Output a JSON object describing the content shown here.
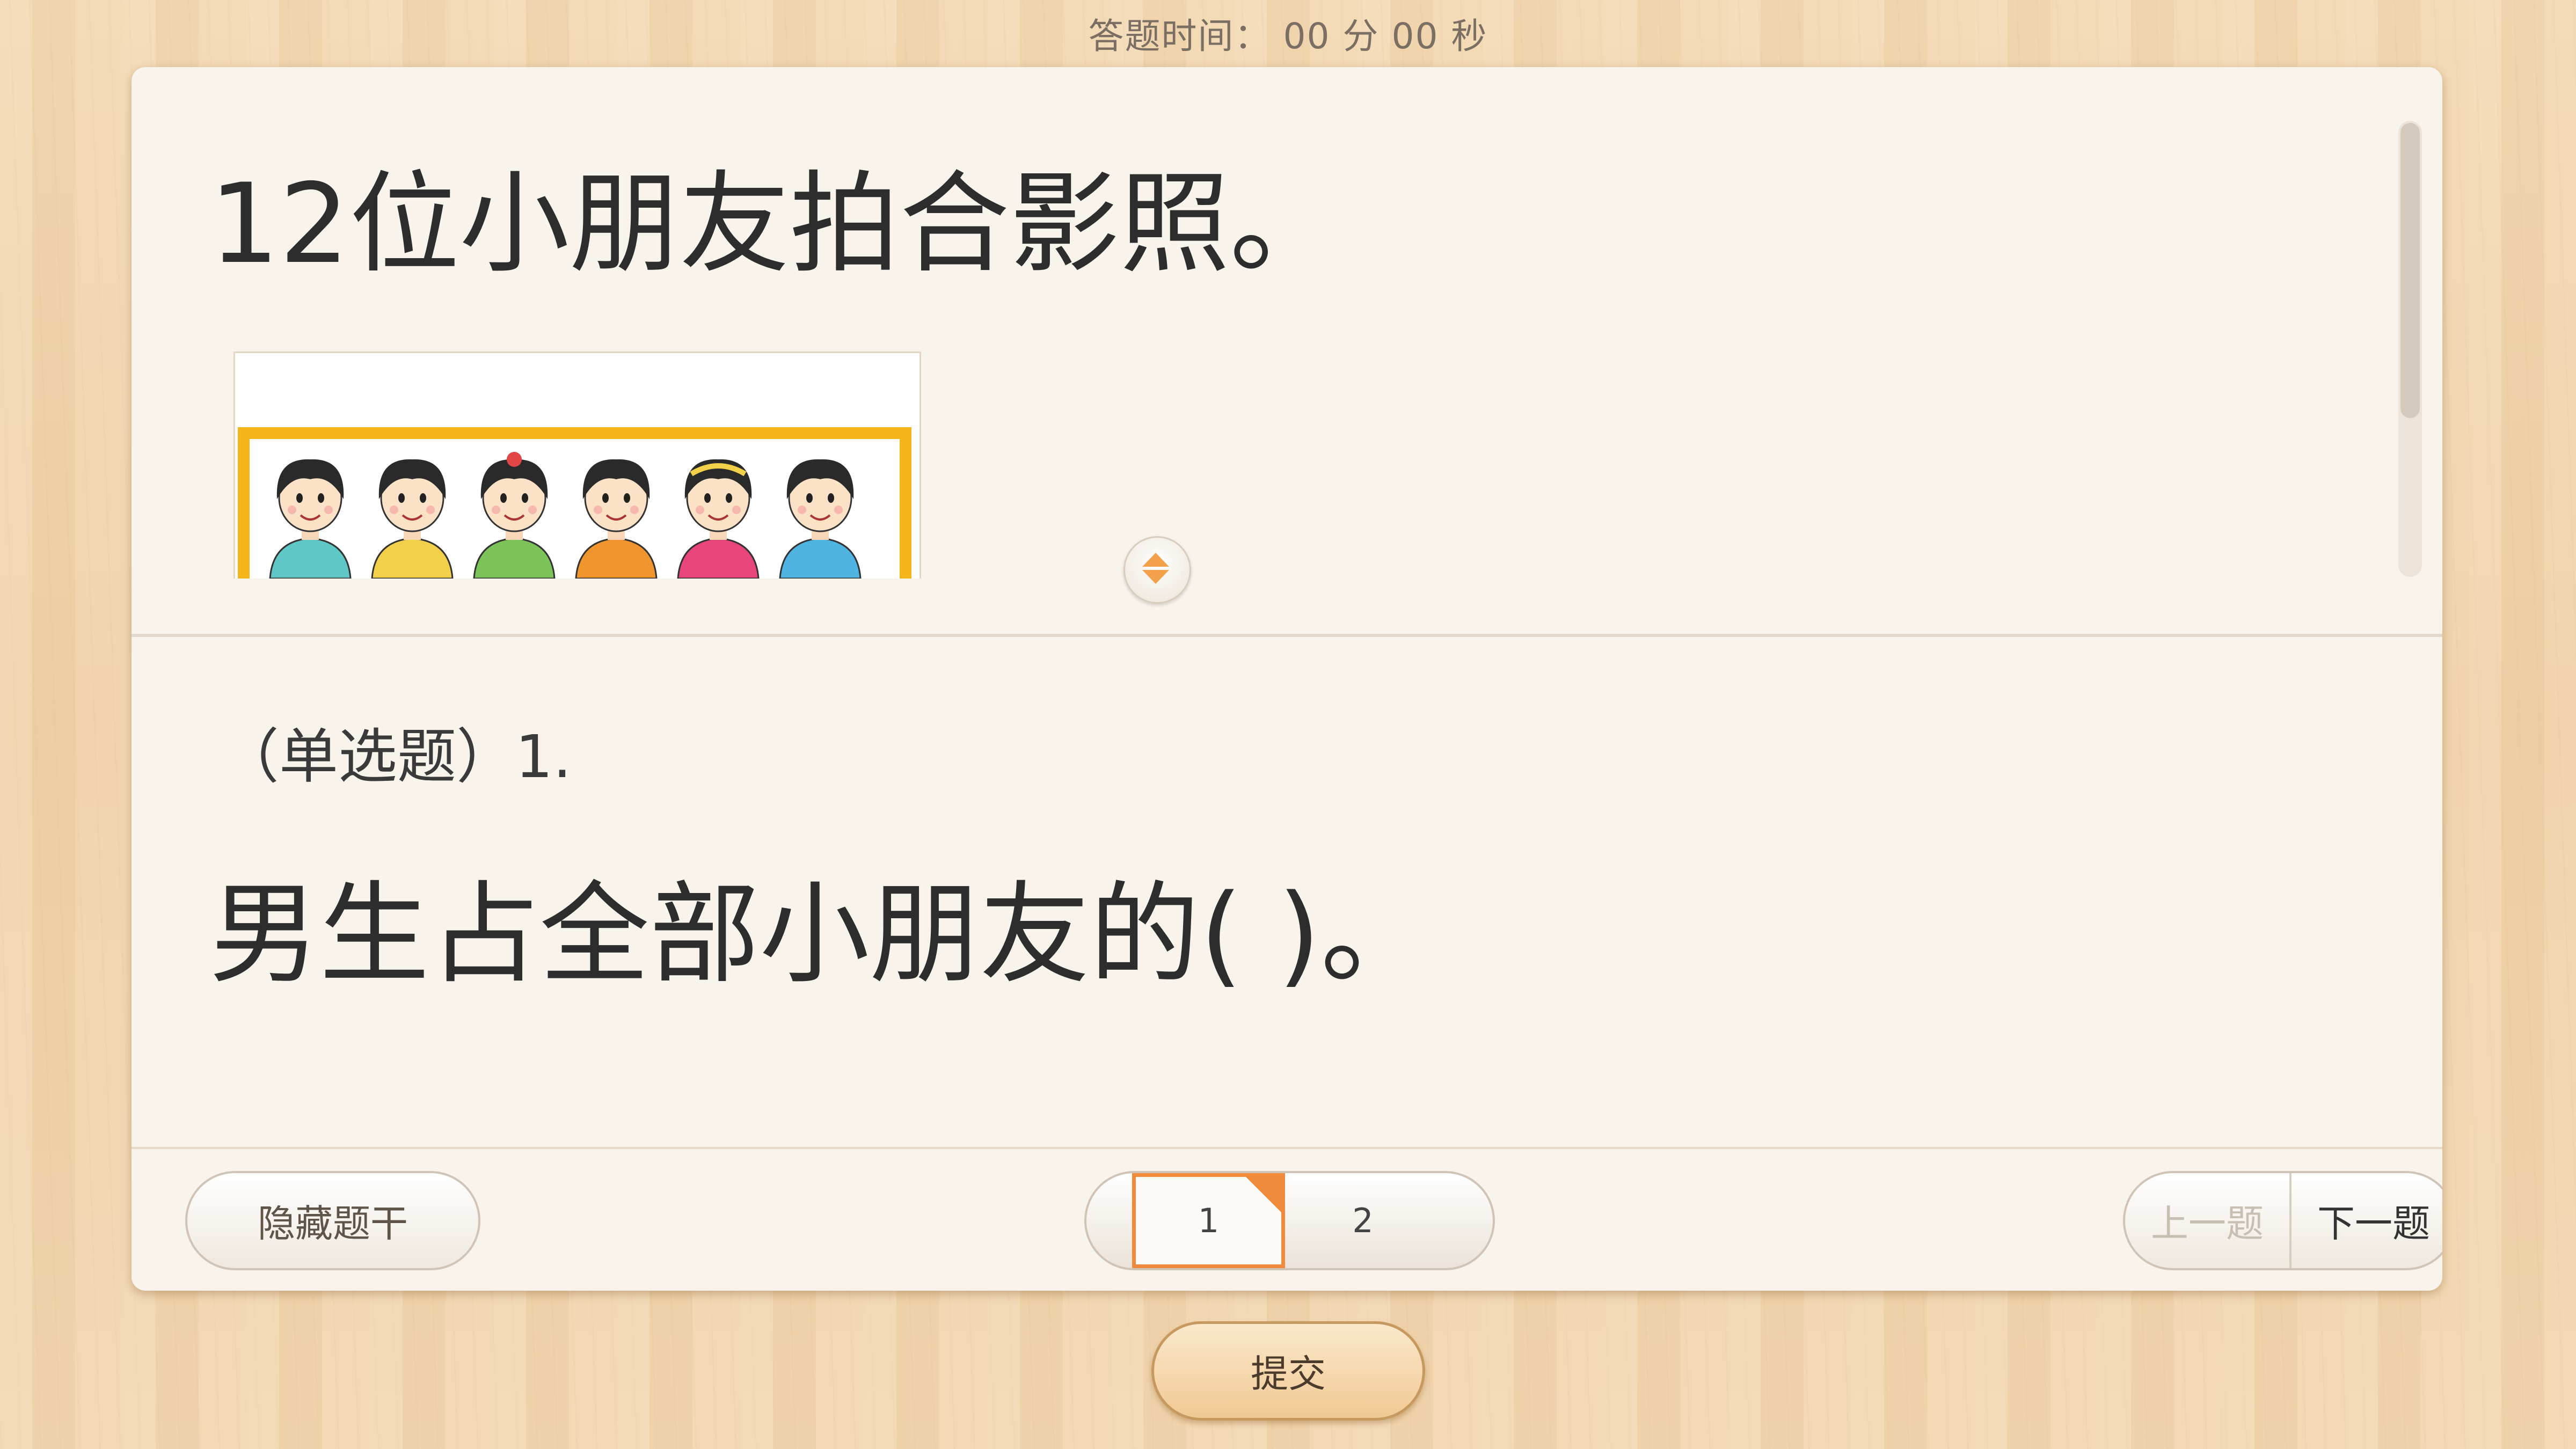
{
  "timer": {
    "text": "答题时间：  00 分 00 秒"
  },
  "stem": {
    "title": "12位小朋友拍合影照。"
  },
  "question": {
    "type_label": "（单选题）1.",
    "text": "男生占全部小朋友的(    )。"
  },
  "footer": {
    "hide_stem_label": "隐藏题干",
    "pages": [
      "1",
      "2"
    ],
    "current_page": "1",
    "prev_label": "上一题",
    "next_label": "下一题"
  },
  "submit_label": "提交",
  "colors": {
    "accent": "#f08a3c",
    "frame_yellow": "#f5b51a",
    "card_bg": "#f8f3eb",
    "wood_bg": "#f0d2a8"
  },
  "figure_people": [
    {
      "shirt": "#5fc8c6",
      "hair": "#2a2a2a"
    },
    {
      "shirt": "#f2d04a",
      "hair": "#2a2a2a"
    },
    {
      "shirt": "#7cc35a",
      "hair": "#2a2a2a",
      "bow": "#e24545"
    },
    {
      "shirt": "#f0942d",
      "hair": "#2a2a2a"
    },
    {
      "shirt": "#e8457a",
      "hair": "#2a2a2a",
      "band": "#f2d04a"
    },
    {
      "shirt": "#4fb4e2",
      "hair": "#2a2a2a"
    }
  ]
}
